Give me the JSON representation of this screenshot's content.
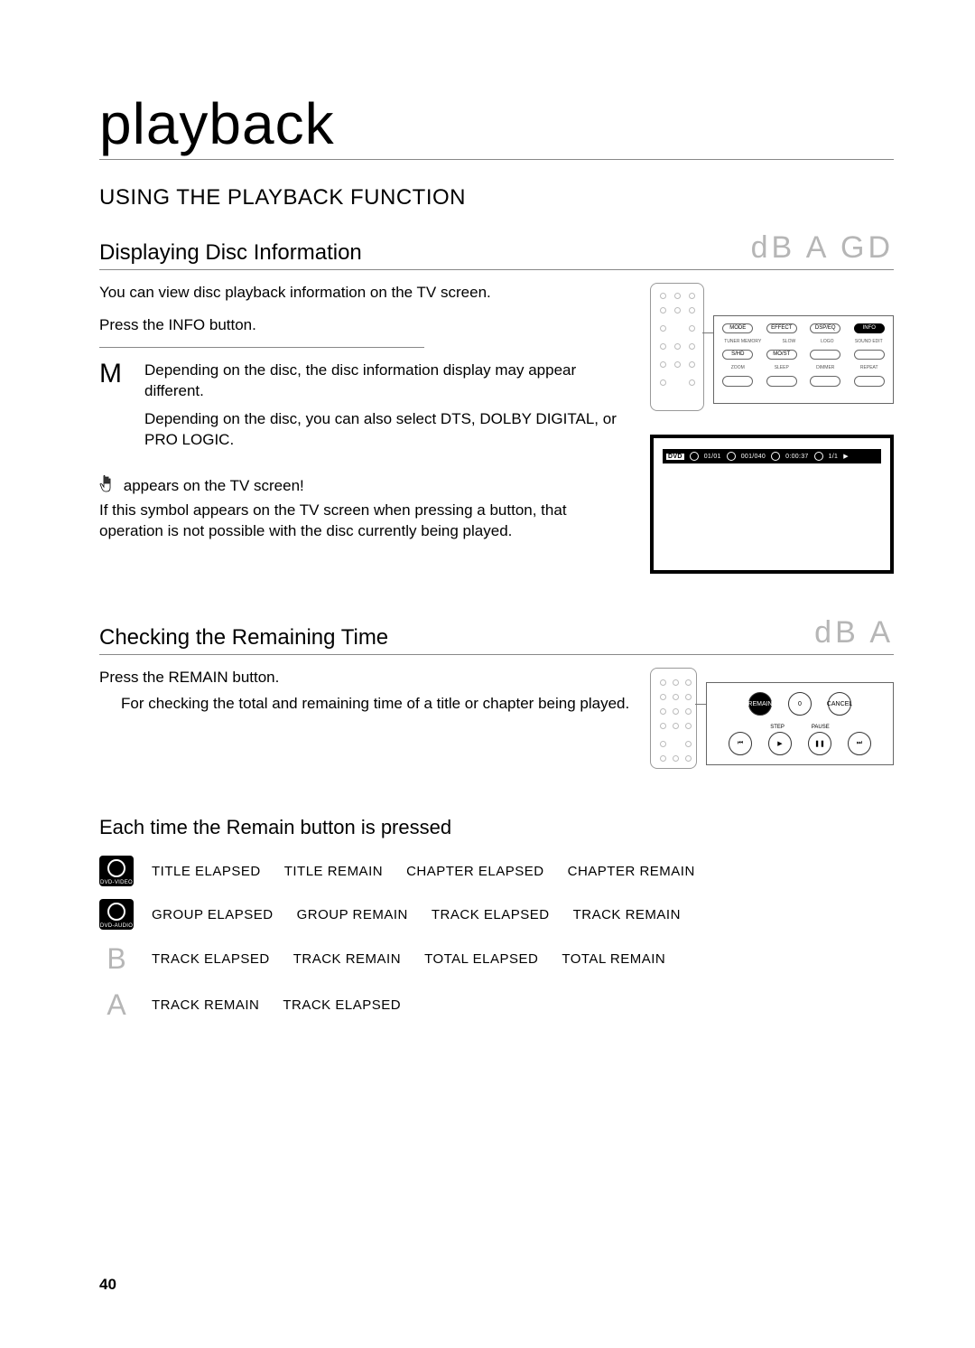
{
  "page_number": "40",
  "chapter_title": "playback",
  "section_heading": "USING THE PLAYBACK FUNCTION",
  "disc_info": {
    "subheading": "Displaying Disc Information",
    "codes": "dB  A GD",
    "intro": "You can view disc playback information  on the TV screen.",
    "step": "Press the INFO button.",
    "note_glyph": "M",
    "note_line1": "Depending on the disc, the disc information display may appear different.",
    "note_line2": "Depending on the disc, you can also select DTS, DOLBY DIGITAL, or PRO LOGIC.",
    "hand_text": "appears on the TV screen!",
    "hand_body": "If this symbol appears on the TV screen when pressing a button, that operation is not possible with the disc currently being played.",
    "remote_labels": {
      "row1": [
        "MODE",
        "EFFECT",
        "DSP/EQ",
        "INFO"
      ],
      "row2_labels": [
        "TUNER MEMORY",
        "SLOW",
        "LOGO",
        "SOUND EDIT"
      ],
      "row3": [
        "S/HD",
        "MO/ST",
        "",
        ""
      ],
      "row4_labels": [
        "ZOOM",
        "SLEEP",
        "DIMMER",
        "REPEAT"
      ]
    },
    "osd": {
      "disc": "DVD",
      "title": "01/01",
      "chapter": "001/040",
      "time": "0:00:37",
      "audio": "1/1",
      "play": "▶"
    }
  },
  "remain": {
    "subheading": "Checking the Remaining Time",
    "codes": "dB  A",
    "step": "Press the REMAIN button.",
    "body": "For checking the total and remaining time of a title or chapter being played.",
    "remote": {
      "remain": "REMAIN",
      "zero": "0",
      "cancel": "CANCEL",
      "step_lbl": "STEP",
      "pause_lbl": "PAUSE",
      "prev": "⏮",
      "play": "▶",
      "pause": "❚❚",
      "next": "⏭"
    },
    "table_heading": "Each time the Remain button is pressed",
    "rows": [
      {
        "badge_type": "disc",
        "badge_label": "DVD-VIDEO",
        "items": [
          "TITLE ELAPSED",
          "TITLE REMAIN",
          "CHAPTER ELAPSED",
          "CHAPTER REMAIN"
        ]
      },
      {
        "badge_type": "disc",
        "badge_label": "DVD-AUDIO",
        "items": [
          "GROUP ELAPSED",
          "GROUP REMAIN",
          "TRACK ELAPSED",
          "TRACK REMAIN"
        ]
      },
      {
        "badge_type": "letter",
        "badge_label": "B",
        "items": [
          "TRACK ELAPSED",
          "TRACK REMAIN",
          "TOTAL ELAPSED",
          "TOTAL REMAIN"
        ]
      },
      {
        "badge_type": "letter",
        "badge_label": "A",
        "items": [
          "TRACK REMAIN",
          "TRACK ELAPSED"
        ]
      }
    ]
  }
}
